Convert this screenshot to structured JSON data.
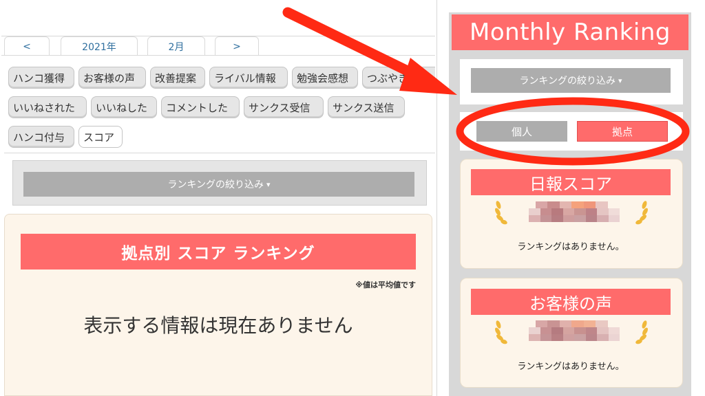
{
  "nav": {
    "prev": "<",
    "year": "2021年",
    "month": "2月",
    "next": ">"
  },
  "chips": [
    "ハンコ獲得",
    "お客様の声",
    "改善提案",
    "ライバル情報",
    "勉強会感想",
    "つぶやき",
    "いいねされた",
    "いいねした",
    "コメントした",
    "サンクス受信",
    "サンクス送信",
    "ハンコ付与",
    "スコア"
  ],
  "active_chip": "スコア",
  "filter": {
    "label": "ランキングの絞り込み",
    "chevron": "⌄"
  },
  "ranking": {
    "title": "拠点別 スコア ランキング",
    "note": "※値は平均値です",
    "empty": "表示する情報は現在ありません"
  },
  "sidebar": {
    "title": "Monthly Ranking",
    "filter_label": "ランキングの絞り込み",
    "toggle": {
      "personal": "個人",
      "base": "拠点"
    },
    "cards": [
      {
        "title": "日報スコア",
        "empty": "ランキングはありません。"
      },
      {
        "title": "お客様の声",
        "empty": "ランキングはありません。"
      }
    ]
  },
  "colors": {
    "accent": "#ff6b6b",
    "annotation_red": "#ff2a14",
    "filter_gray": "#adadad",
    "card_bg": "#fdf5ea"
  },
  "icons": {
    "laurel": "laurel-icon",
    "chevron": "chevron-down-icon"
  }
}
